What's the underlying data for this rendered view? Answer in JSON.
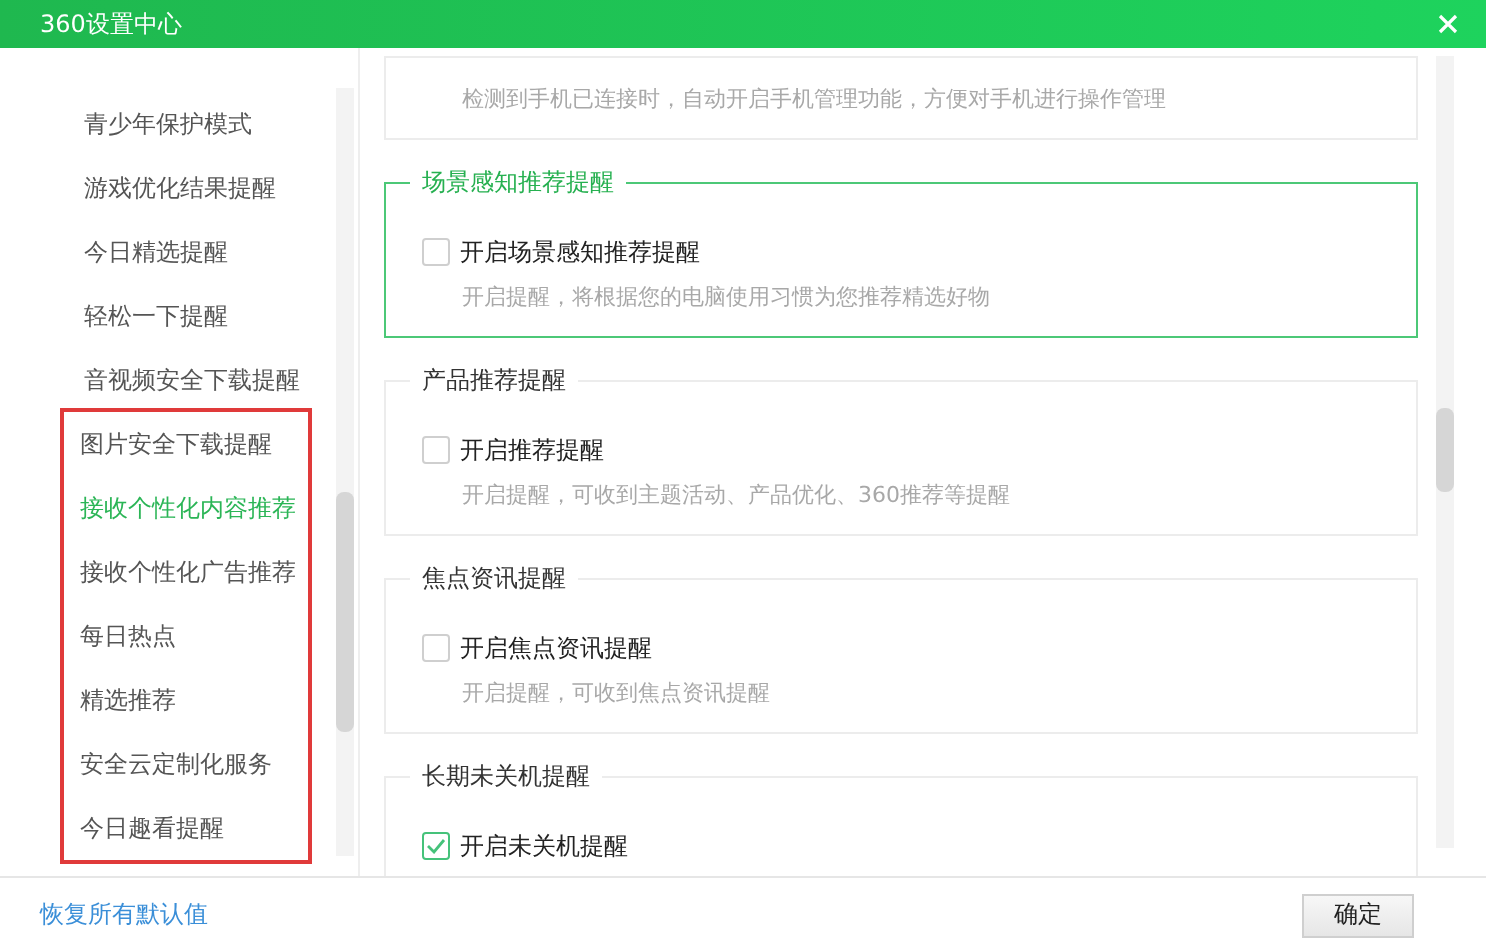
{
  "window": {
    "title": "360设置中心"
  },
  "sidebar": {
    "items": [
      {
        "label": "青少年保护模式",
        "selected": false
      },
      {
        "label": "游戏优化结果提醒",
        "selected": false
      },
      {
        "label": "今日精选提醒",
        "selected": false
      },
      {
        "label": "轻松一下提醒",
        "selected": false
      },
      {
        "label": "音视频安全下载提醒",
        "selected": false
      }
    ],
    "annotated_group": {
      "items": [
        {
          "label": "图片安全下载提醒",
          "selected": false
        },
        {
          "label": "接收个性化内容推荐",
          "selected": true
        },
        {
          "label": "接收个性化广告推荐",
          "selected": false
        },
        {
          "label": "每日热点",
          "selected": false
        },
        {
          "label": "精选推荐",
          "selected": false
        },
        {
          "label": "安全云定制化服务",
          "selected": false
        },
        {
          "label": "今日趣看提醒",
          "selected": false
        }
      ]
    }
  },
  "sections": [
    {
      "selected": false,
      "description": "检测到手机已连接时，自动开启手机管理功能，方便对手机进行操作管理"
    },
    {
      "title": "场景感知推荐提醒",
      "selected": true,
      "option": {
        "label": "开启场景感知推荐提醒",
        "checked": false
      },
      "description": "开启提醒，将根据您的电脑使用习惯为您推荐精选好物"
    },
    {
      "title": "产品推荐提醒",
      "selected": false,
      "option": {
        "label": "开启推荐提醒",
        "checked": false
      },
      "description": "开启提醒，可收到主题活动、产品优化、360推荐等提醒"
    },
    {
      "title": "焦点资讯提醒",
      "selected": false,
      "option": {
        "label": "开启焦点资讯提醒",
        "checked": false
      },
      "description": "开启提醒，可收到焦点资讯提醒"
    },
    {
      "title": "长期未关机提醒",
      "selected": false,
      "option": {
        "label": "开启未关机提醒",
        "checked": true
      }
    }
  ],
  "footer": {
    "reset_link": "恢复所有默认值",
    "ok_button": "确定"
  }
}
